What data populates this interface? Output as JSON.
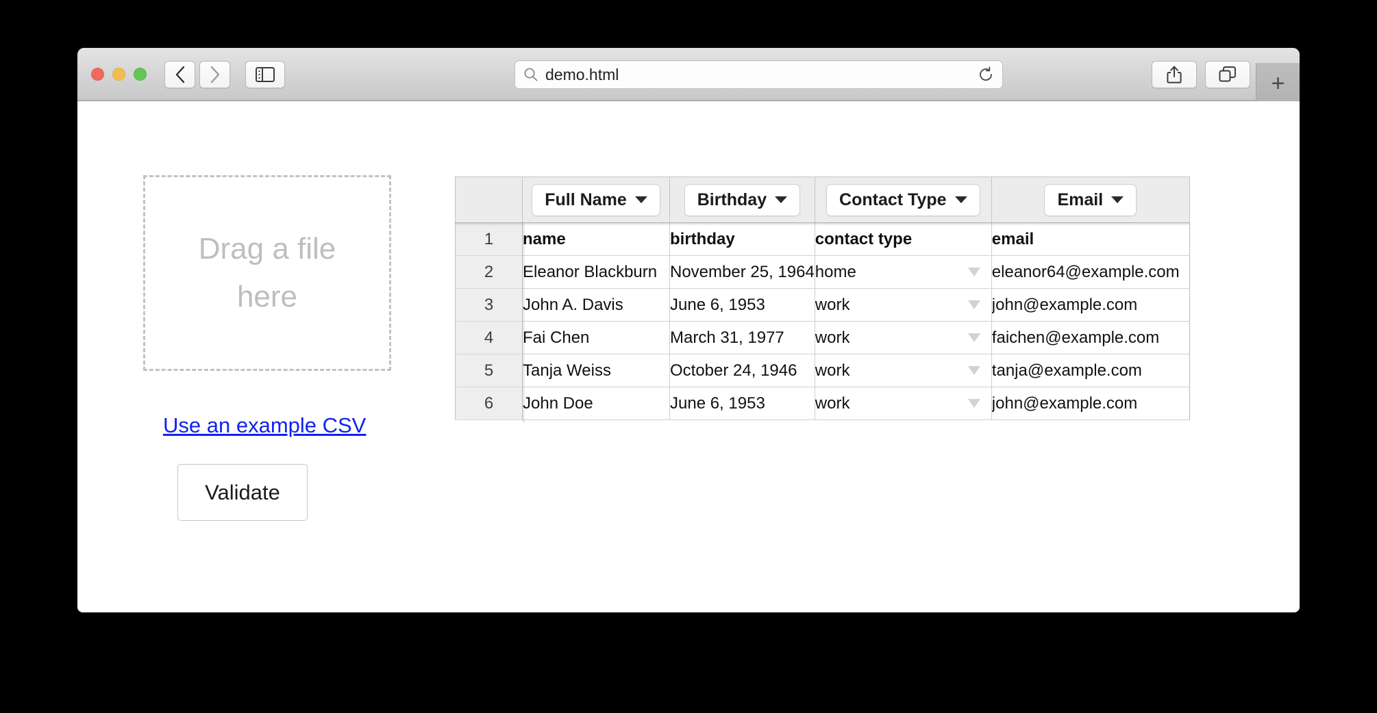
{
  "browser": {
    "traffic_lights": [
      {
        "name": "close",
        "color": "#ef6a5d"
      },
      {
        "name": "minimize",
        "color": "#f3bc4f"
      },
      {
        "name": "maximize",
        "color": "#61c655"
      }
    ],
    "back_label": "‹",
    "forward_label": "›",
    "sidebar_icon": "sidebar-icon",
    "address": {
      "value": "demo.html",
      "placeholder": "Search or enter website name",
      "search_icon": "search-icon",
      "reload_icon": "reload-icon"
    },
    "share_icon": "share-icon",
    "tab_overview_icon": "tab-overview-icon",
    "new_tab_label": "+"
  },
  "page": {
    "drop_zone_label": "Drag a file here",
    "example_link_label": "Use an example CSV",
    "validate_label": "Validate",
    "link_color": "#1122ee"
  },
  "table": {
    "columns": [
      {
        "key": "gutter",
        "header_label": "",
        "has_select": false
      },
      {
        "key": "name",
        "header_label": "Full Name",
        "has_select": true
      },
      {
        "key": "bday",
        "header_label": "Birthday",
        "has_select": true
      },
      {
        "key": "ctype",
        "header_label": "Contact Type",
        "has_select": true
      },
      {
        "key": "email",
        "header_label": "Email",
        "has_select": true
      }
    ],
    "rows": [
      {
        "num": "1",
        "name": "name",
        "bday": "birthday",
        "ctype": "contact type",
        "email": "email",
        "is_header_row": true,
        "ctype_is_select": false
      },
      {
        "num": "2",
        "name": "Eleanor Blackburn",
        "bday": "November 25, 1964",
        "ctype": "home",
        "email": "eleanor64@example.com",
        "is_header_row": false,
        "ctype_is_select": true
      },
      {
        "num": "3",
        "name": "John A. Davis",
        "bday": "June 6, 1953",
        "ctype": "work",
        "email": "john@example.com",
        "is_header_row": false,
        "ctype_is_select": true
      },
      {
        "num": "4",
        "name": "Fai Chen",
        "bday": "March 31, 1977",
        "ctype": "work",
        "email": "faichen@example.com",
        "is_header_row": false,
        "ctype_is_select": true
      },
      {
        "num": "5",
        "name": "Tanja Weiss",
        "bday": "October 24, 1946",
        "ctype": "work",
        "email": "tanja@example.com",
        "is_header_row": false,
        "ctype_is_select": true
      },
      {
        "num": "6",
        "name": "John Doe",
        "bday": "June 6, 1953",
        "ctype": "work",
        "email": "john@example.com",
        "is_header_row": false,
        "ctype_is_select": true
      }
    ]
  }
}
